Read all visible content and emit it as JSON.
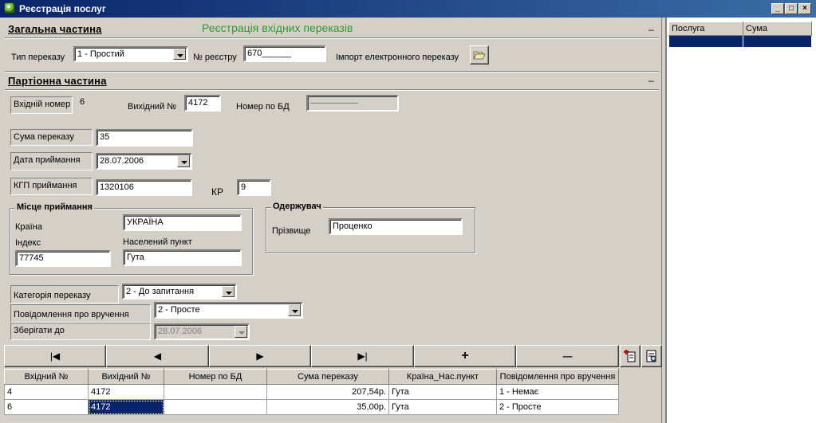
{
  "window": {
    "title": "Реєстрація послуг",
    "min": "_",
    "max": "□",
    "close": "×"
  },
  "general": {
    "section_title": "Загальна частина",
    "collapse": "–",
    "heading": "Реєстрація вхідних переказів",
    "heading_color": "#2e9a2e",
    "transfer_type_label": "Тип переказу",
    "transfer_type_value": "1 - Простий",
    "registry_label": "№ реєстру",
    "registry_value": "670______",
    "import_label": "Імпорт електронного переказу",
    "import_icon": "folder-open-icon"
  },
  "batch": {
    "section_title": "Партіонна частина",
    "collapse": "–",
    "incoming_number_label": "Вхідній номер",
    "incoming_number_value": "6",
    "outgoing_number_label": "Вихідний №",
    "outgoing_number_value": "4172",
    "db_number_label": "Номер по БД",
    "db_number_value": "",
    "amount_label": "Сума переказу",
    "amount_value": "35",
    "date_label": "Дата приймання",
    "date_value": "28.07.2006",
    "kgp_label": "КГП приймання",
    "kgp_value": "1320106",
    "kp_label": "КР",
    "kp_value": "9"
  },
  "place": {
    "group_title": "Місце приймання",
    "country_label": "Країна",
    "country_value": "УКРАЇНА",
    "index_label": "Індекс",
    "index_value": "77745",
    "settlement_label": "Населений пункт",
    "settlement_value": "Гута"
  },
  "recipient": {
    "group_title": "Одержувач",
    "surname_label": "Прізвище",
    "surname_value": "Проценко"
  },
  "options": {
    "category_label": "Категорія переказу",
    "category_value": "2 - До запитання",
    "notice_label": "Повідомлення про вручення",
    "notice_value": "2 - Просте",
    "keep_until_label": "Зберігати до",
    "keep_until_value": "28.07.2006"
  },
  "navigator": {
    "first": "|◀",
    "prev": "◀",
    "next": "▶",
    "last": "▶|",
    "add": "+",
    "delete": "—",
    "icon_a": "add-record-icon",
    "icon_b": "print-preview-icon"
  },
  "table": {
    "columns": [
      "Вхідний №",
      "Вихідний №",
      "Номер по БД",
      "Сума переказу",
      "Країна_Нас.пункт",
      "Повідомлення про вручення"
    ],
    "rows": [
      [
        "4",
        "4172",
        "",
        "207,54р.",
        "Гута",
        "1 - Немає"
      ],
      [
        "6",
        "4172",
        "",
        "35,00р.",
        "Гута",
        "2 - Просте"
      ]
    ]
  },
  "services": {
    "columns": [
      "Послуга",
      "Сума"
    ]
  }
}
